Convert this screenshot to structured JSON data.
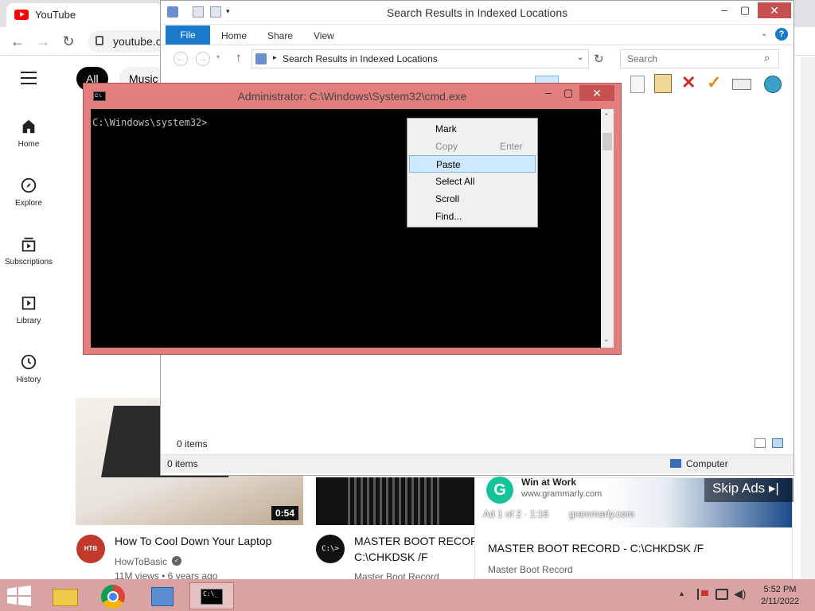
{
  "browser": {
    "tab_title": "YouTube",
    "url": "youtube.c",
    "chips": [
      "All",
      "Music"
    ],
    "sidebar": [
      {
        "label": "Home",
        "icon": "home-icon"
      },
      {
        "label": "Explore",
        "icon": "compass-icon"
      },
      {
        "label": "Subscriptions",
        "icon": "subscriptions-icon"
      },
      {
        "label": "Library",
        "icon": "library-icon"
      },
      {
        "label": "History",
        "icon": "history-icon"
      }
    ],
    "videos": [
      {
        "title": "How To Cool Down Your Laptop",
        "channel": "HowToBasic",
        "meta": "11M views • 6 years ago",
        "duration": "0:54"
      },
      {
        "title": "MASTER BOOT RECORD - C:\\CHKDSK /F",
        "title_short": "MASTER BOOT RECORD",
        "title_line2": "C:\\CHKDSK /F",
        "channel": "Master Boot Record"
      }
    ],
    "ad": {
      "headline": "Win at Work",
      "site": "www.grammarly.com",
      "counter": "Ad 1 of 2 · 1:16",
      "domain": "grammarly.com",
      "skip": "Skip Ads",
      "video_title": "MASTER BOOT RECORD - C:\\CHKDSK /F",
      "channel": "Master Boot Record"
    }
  },
  "explorer": {
    "title": "Search Results in Indexed Locations",
    "tabs": [
      "File",
      "Home",
      "Share",
      "View"
    ],
    "address": "Search Results in Indexed Locations",
    "search_placeholder": "Search",
    "items_count": "0 items",
    "status_items": "0 items",
    "status_location": "Computer"
  },
  "cmd": {
    "title": "Administrator: C:\\Windows\\System32\\cmd.exe",
    "prompt": "C:\\Windows\\system32>",
    "icon_text": "C:\\."
  },
  "context_menu": {
    "items": [
      {
        "label": "Mark",
        "enabled": true
      },
      {
        "label": "Copy",
        "accel": "Enter",
        "enabled": false
      },
      {
        "label": "Paste",
        "enabled": true,
        "selected": true
      },
      {
        "label": "Select All",
        "enabled": true
      },
      {
        "label": "Scroll",
        "enabled": true
      },
      {
        "label": "Find...",
        "enabled": true
      }
    ]
  },
  "taskbar": {
    "time": "5:52 PM",
    "date": "2/11/2022",
    "accent": "#d9a3a3"
  }
}
